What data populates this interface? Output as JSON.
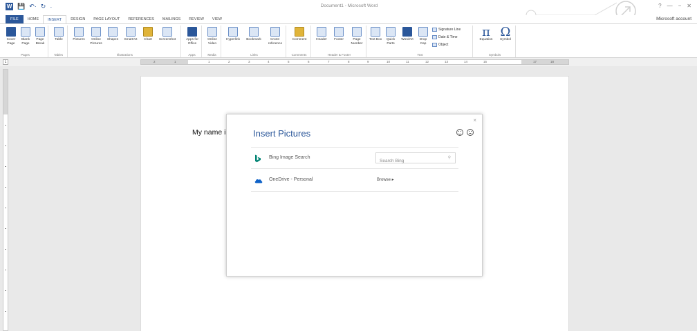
{
  "window": {
    "title": "Document1 - Microsoft Word",
    "controls": [
      "?",
      "―",
      "−",
      "✕"
    ],
    "account": "Microsoft account"
  },
  "qat": {
    "logo": "W",
    "undo": "↶·",
    "redo": "↻",
    "customize": "·"
  },
  "tabs": [
    "FILE",
    "HOME",
    "INSERT",
    "DESIGN",
    "PAGE LAYOUT",
    "REFERENCES",
    "MAILINGS",
    "REVIEW",
    "VIEW"
  ],
  "active_tab": "INSERT",
  "ribbon": {
    "groups": [
      "Pages",
      "Tables",
      "Illustrations",
      "Apps",
      "Media",
      "Links",
      "Comments",
      "Header & Footer",
      "Text",
      "Symbols"
    ],
    "pages": [
      "Cover Page",
      "Blank Page",
      "Page Break"
    ],
    "tables": [
      "Table"
    ],
    "illustrations": [
      "Pictures",
      "Online Pictures",
      "Shapes",
      "SmartArt",
      "Chart",
      "Screenshot"
    ],
    "apps": [
      "Apps for Office"
    ],
    "media": [
      "Online Video"
    ],
    "links": [
      "Hyperlink",
      "Bookmark",
      "Cross-reference"
    ],
    "comments": [
      "Comment"
    ],
    "header_footer": [
      "Header",
      "Footer",
      "Page Number"
    ],
    "text": [
      "Text Box",
      "Quick Parts",
      "WordArt",
      "Drop Cap"
    ],
    "text_small": [
      "Signature Line",
      "Date & Time",
      "Object"
    ],
    "symbols": [
      "Equation",
      "Symbol"
    ],
    "symbol_glyphs": [
      "π",
      "Ω"
    ]
  },
  "ruler_numbers": [
    "2",
    "1",
    "1",
    "2",
    "3",
    "4",
    "5",
    "6",
    "7",
    "8",
    "9",
    "10",
    "11",
    "12",
    "13",
    "14",
    "15",
    "17",
    "18"
  ],
  "document": {
    "text": "My name i"
  },
  "dialog": {
    "title": "Insert Pictures",
    "close": "×",
    "rows": [
      {
        "label": "Bing Image Search",
        "search_placeholder": "Search Bing"
      },
      {
        "label": "OneDrive - Personal",
        "action": "Browse ▸"
      }
    ]
  },
  "colors": {
    "accent": "#2b579a",
    "bing": "#008373",
    "onedrive": "#0f62c8"
  }
}
